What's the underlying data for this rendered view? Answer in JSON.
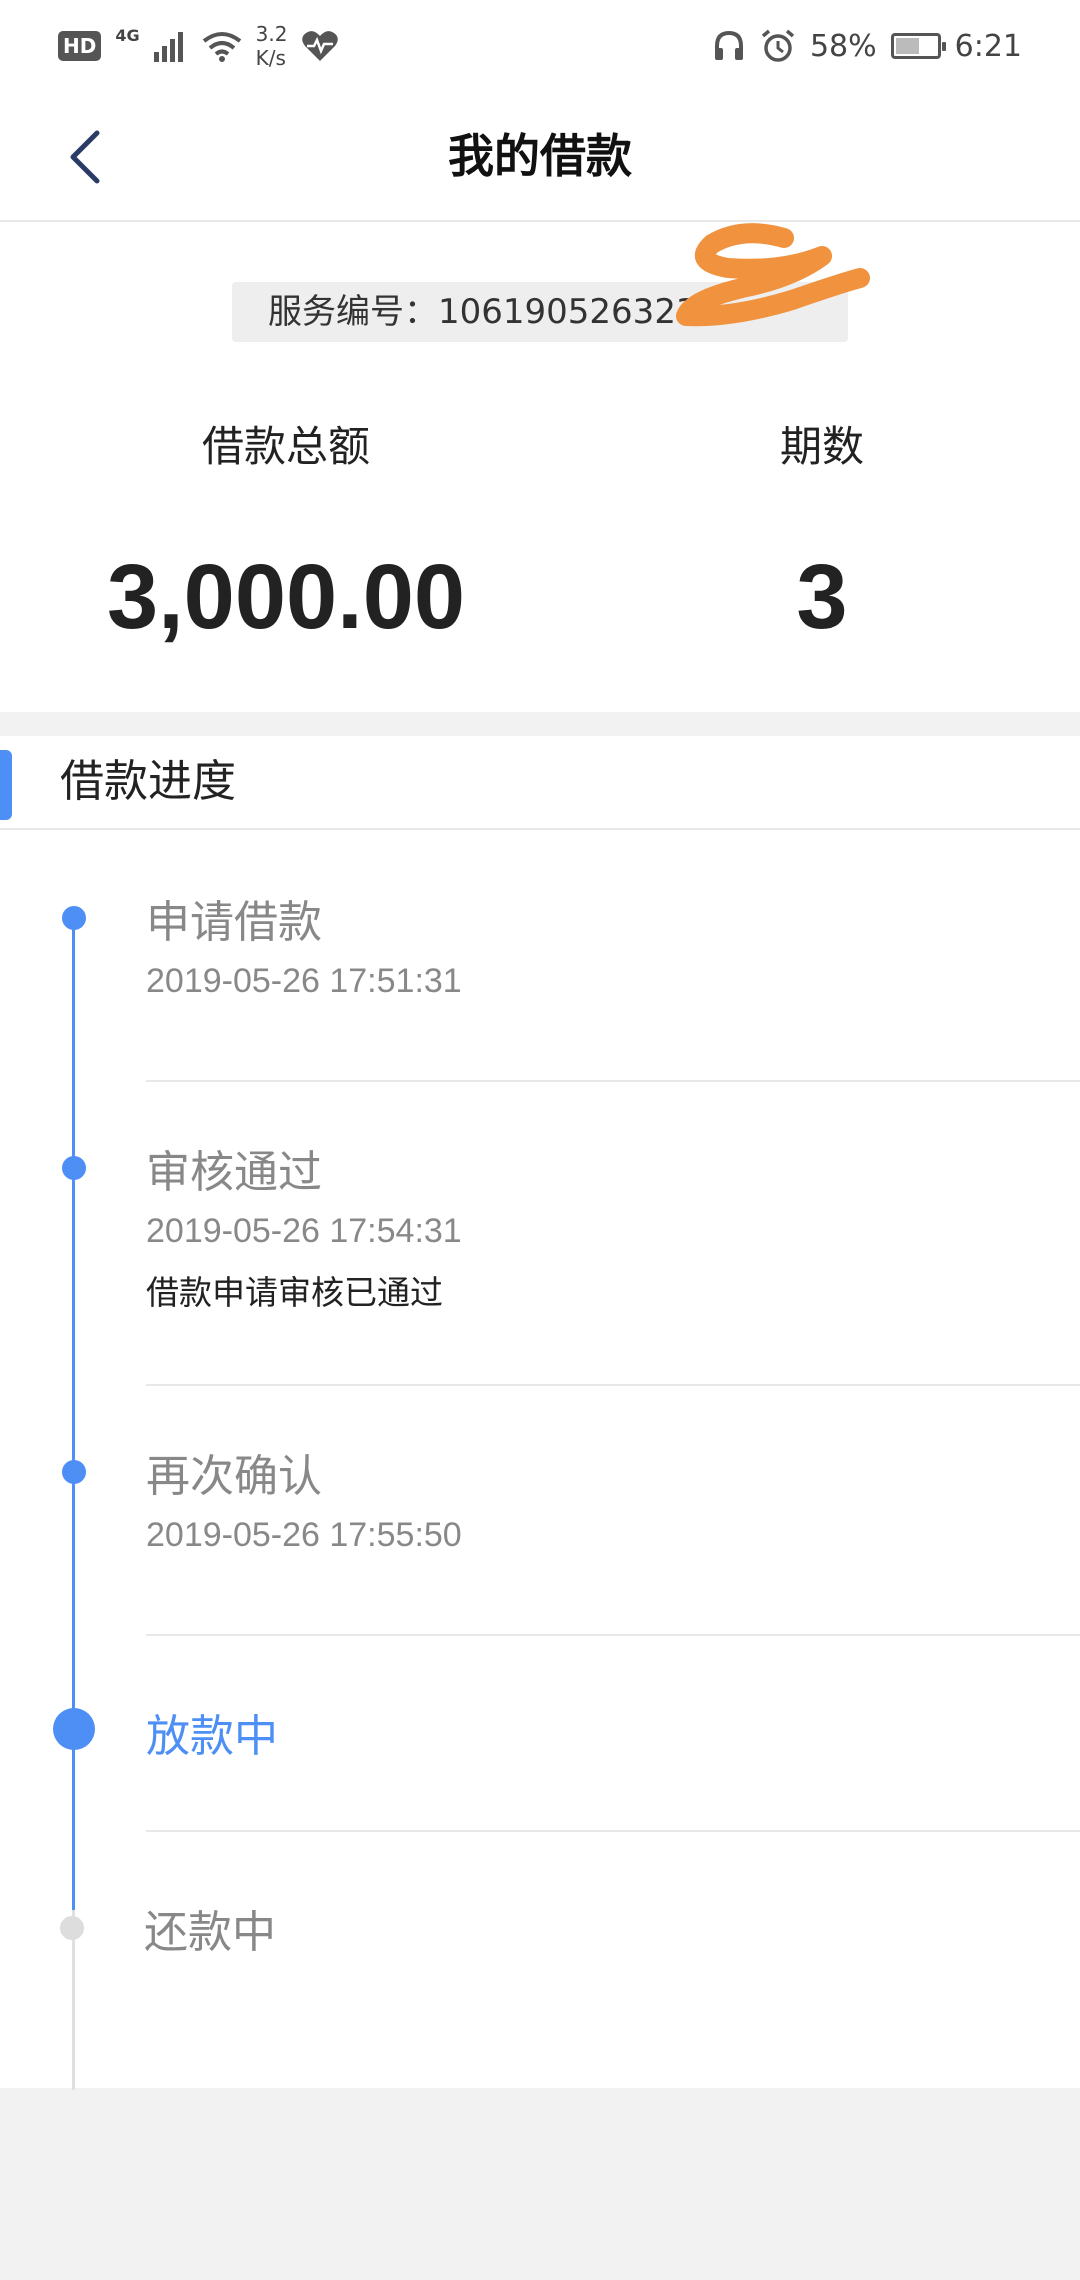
{
  "status_bar": {
    "hd": "HD",
    "network": "4G",
    "speed_value": "3.2",
    "speed_unit": "K/s",
    "battery_pct": "58%",
    "battery_level": 0.58,
    "time": "6:21"
  },
  "header": {
    "title": "我的借款",
    "back_icon": "chevron-left-icon"
  },
  "summary": {
    "service_label": "服务编号：",
    "service_number": "1061905263230",
    "amount_label": "借款总额",
    "amount_value": "3,000.00",
    "periods_label": "期数",
    "periods_value": "3"
  },
  "progress": {
    "title": "借款进度",
    "steps": [
      {
        "title": "申请借款",
        "time": "2019-05-26 17:51:31",
        "note": "",
        "state": "done"
      },
      {
        "title": "审核通过",
        "time": "2019-05-26 17:54:31",
        "note": "借款申请审核已通过",
        "state": "done"
      },
      {
        "title": "再次确认",
        "time": "2019-05-26 17:55:50",
        "note": "",
        "state": "done"
      },
      {
        "title": "放款中",
        "time": "",
        "note": "",
        "state": "active"
      },
      {
        "title": "还款中",
        "time": "",
        "note": "",
        "state": "pending"
      }
    ]
  },
  "colors": {
    "accent": "#4d8ff5",
    "muted_text": "#888888",
    "pending_dot": "#dddddd",
    "redaction": "#f0923e"
  }
}
